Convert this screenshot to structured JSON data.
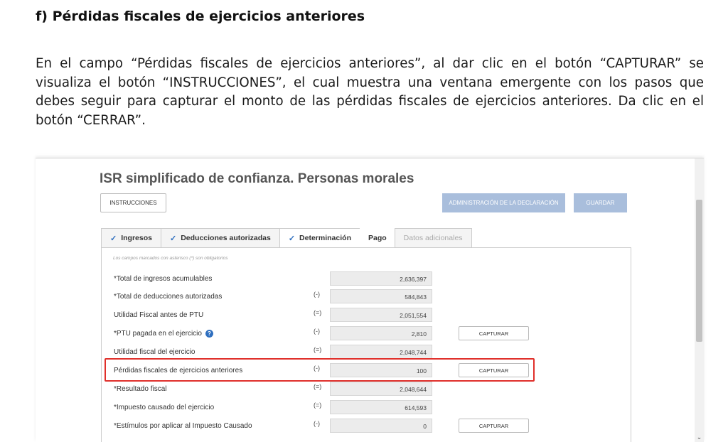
{
  "document": {
    "heading": "f) Pérdidas fiscales de ejercicios anteriores",
    "paragraph": "En el campo “Pérdidas fiscales de ejercicios anteriores”, al dar clic en el botón “CAPTURAR” se visualiza el botón “INSTRUCCIONES”, el cual muestra una ventana emergente con los pasos que debes seguir para capturar el monto de las pérdidas fiscales de ejercicios anteriores. Da clic en el botón “CERRAR”."
  },
  "form": {
    "title": "ISR simplificado de confianza. Personas morales",
    "instructions_button": "INSTRUCCIONES",
    "admin_button": "ADMINISTRACIÓN DE LA DECLARACIÓN",
    "save_button": "GUARDAR",
    "tabs": [
      {
        "label": "Ingresos",
        "checked": true,
        "state": "normal"
      },
      {
        "label": "Deducciones autorizadas",
        "checked": true,
        "state": "normal"
      },
      {
        "label": "Determinación",
        "checked": true,
        "state": "active"
      },
      {
        "label": "Pago",
        "checked": false,
        "state": "plain"
      },
      {
        "label": "Datos adicionales",
        "checked": false,
        "state": "dim"
      }
    ],
    "required_note": "Los campos marcados con asterisco (*) son obligatorios",
    "rows": [
      {
        "label": "*Total de ingresos acumulables",
        "op": "",
        "value": "2,636,397",
        "button": "",
        "help": false
      },
      {
        "label": "*Total de deducciones autorizadas",
        "op": "(-)",
        "value": "584,843",
        "button": "",
        "help": false
      },
      {
        "label": "Utilidad Fiscal antes de PTU",
        "op": "(=)",
        "value": "2,051,554",
        "button": "",
        "help": false
      },
      {
        "label": "*PTU pagada en el ejercicio",
        "op": "(-)",
        "value": "2,810",
        "button": "CAPTURAR",
        "help": true
      },
      {
        "label": "Utilidad fiscal del ejercicio",
        "op": "(=)",
        "value": "2,048,744",
        "button": "",
        "help": false
      },
      {
        "label": "Pérdidas fiscales de ejercicios anteriores",
        "op": "(-)",
        "value": "100",
        "button": "CAPTURAR",
        "help": false
      },
      {
        "label": "*Resultado fiscal",
        "op": "(=)",
        "value": "2,048,644",
        "button": "",
        "help": false
      },
      {
        "label": "*Impuesto causado del ejercicio",
        "op": "(=)",
        "value": "614,593",
        "button": "",
        "help": false
      },
      {
        "label": "*Estímulos por aplicar al Impuesto Causado",
        "op": "(-)",
        "value": "0",
        "button": "CAPTURAR",
        "help": false
      }
    ],
    "colors": {
      "highlight": "#e0302b",
      "accent": "#2f6fbf",
      "disabled_button": "#a9bedc"
    }
  }
}
